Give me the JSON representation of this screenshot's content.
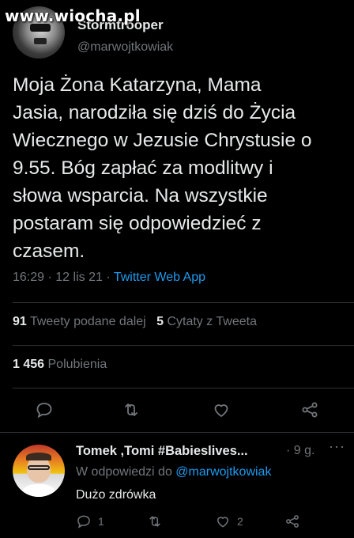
{
  "watermark": "www.wiocha.pl",
  "tweet": {
    "display_name": "Stormtrooper",
    "handle": "@marwojtkowiak",
    "text": "Moja Żona Katarzyna, Mama\nJasia, narodziła się dziś do Życia\nWiecznego w Jezusie Chrystusie o\n9.55. Bóg zapłać za modlitwy i\nsłowa wsparcia. Na wszystkie\npostaram się odpowiedzieć z\nczasem.",
    "time": "16:29",
    "date": "12 lis 21",
    "separator": "·",
    "source": "Twitter Web App"
  },
  "stats": {
    "retweets_count": "91",
    "retweets_label": "Tweety podane dalej",
    "quotes_count": "5",
    "quotes_label": "Cytaty z Tweeta",
    "likes_count": "1 456",
    "likes_label": "Polubienia"
  },
  "actions": {
    "icons": [
      "reply-icon",
      "retweet-icon",
      "like-icon",
      "share-icon"
    ]
  },
  "reply": {
    "name": "Tomek ,Tomi #Babieslives...",
    "time": "· 9 g.",
    "more": "···",
    "reply_to_label": "W odpowiedzi do",
    "reply_to_handle": "@marwojtkowiak",
    "text": "Dużo zdrówka",
    "reply_count": "1",
    "retweet_count": "",
    "like_count": "2"
  },
  "colors": {
    "background": "#000000",
    "text": "#e7e9ea",
    "muted": "#71767b",
    "accent": "#1d9bf0",
    "divider": "#2f3336"
  }
}
